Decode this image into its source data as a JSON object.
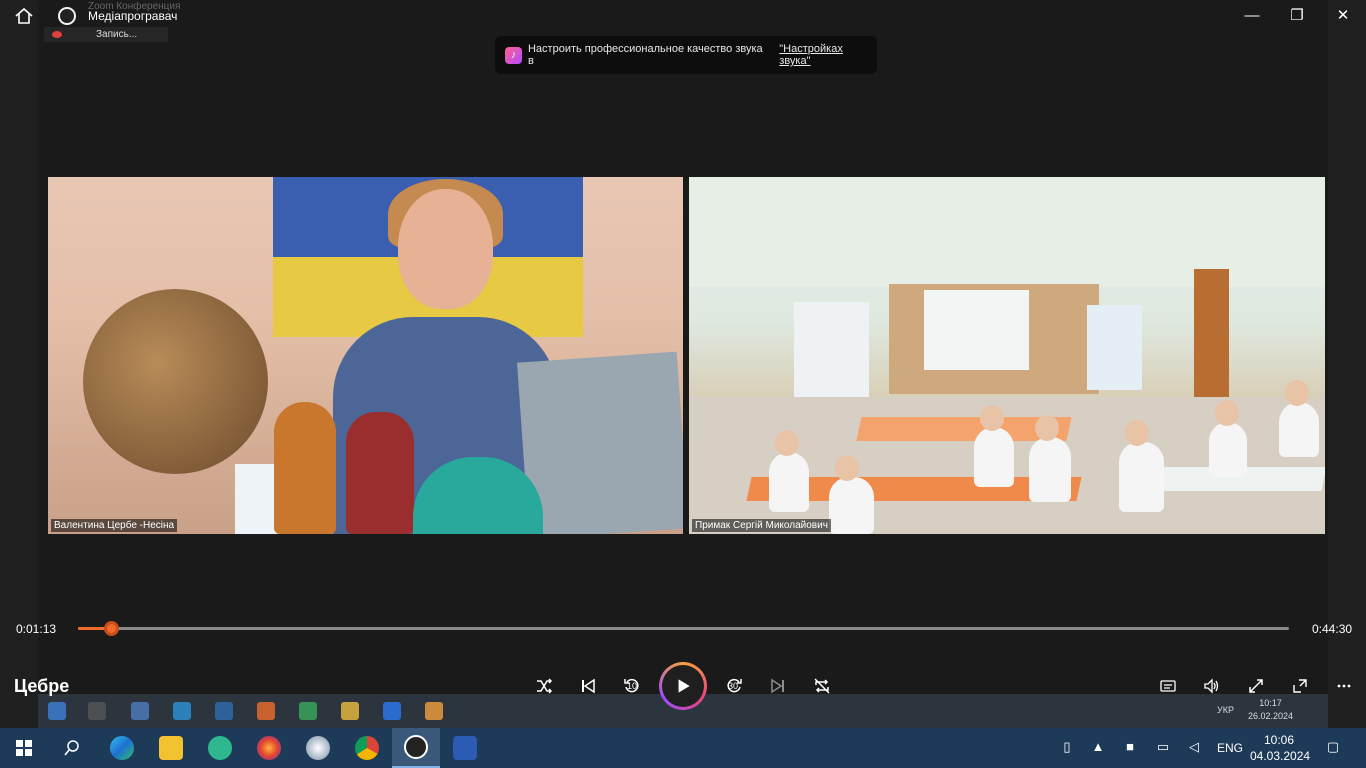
{
  "window": {
    "app_title": "Медіапрогравач",
    "recorded_title": "Zoom Конференция",
    "minimize": "—",
    "maximize": "❐",
    "close": "✕"
  },
  "recording": {
    "label": "Запись..."
  },
  "notice": {
    "text": "Настроить профессиональное качество звука в",
    "link": "\"Настройках звука\""
  },
  "participants": [
    {
      "name": "Валентина Цербе -Несіна"
    },
    {
      "name": "Примак Сергій Миколайович"
    }
  ],
  "player": {
    "elapsed": "0:01:13",
    "duration": "0:44:30",
    "progress_fraction": 0.0273,
    "media_title": "Цебре",
    "skip_back_label": "10",
    "skip_forward_label": "30"
  },
  "recorded_taskbar": {
    "lang": "УКР",
    "time": "10:17",
    "date": "26.02.2024"
  },
  "taskbar": {
    "lang": "ENG",
    "time": "10:06",
    "date": "04.03.2024"
  },
  "colors": {
    "accent": "#f06a2a",
    "taskbar": "#1d3a58",
    "player_bg": "#1f1f1f"
  }
}
